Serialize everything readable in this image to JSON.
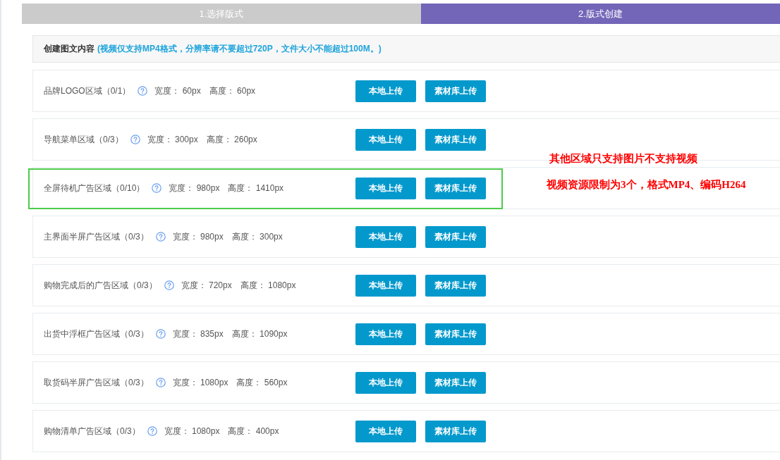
{
  "steps": [
    {
      "label": "1.选择版式",
      "selected": false
    },
    {
      "label": "2.版式创建",
      "selected": true
    }
  ],
  "content_header": {
    "title": "创建图文内容",
    "note": "(视频仅支持MP4格式，分辨率请不要超过720P，文件大小不能超过100M。)"
  },
  "regions": [
    {
      "name": "品牌LOGO区域（0/1）",
      "width": "宽度： 60px",
      "height": "高度： 60px",
      "highlighted": false,
      "buttons": [
        "本地上传",
        "素材库上传"
      ]
    },
    {
      "name": "导航菜单区域（0/3）",
      "width": "宽度： 300px",
      "height": "高度： 260px",
      "highlighted": false,
      "buttons": [
        "本地上传",
        "素材库上传"
      ]
    },
    {
      "name": "全屏待机广告区域（0/10）",
      "width": "宽度： 980px",
      "height": "高度： 1410px",
      "highlighted": true,
      "buttons": [
        "本地上传",
        "素材库上传"
      ]
    },
    {
      "name": "主界面半屏广告区域（0/3）",
      "width": "宽度： 980px",
      "height": "高度： 300px",
      "highlighted": false,
      "buttons": [
        "本地上传",
        "素材库上传"
      ]
    },
    {
      "name": "购物完成后的广告区域（0/3）",
      "width": "宽度： 720px",
      "height": "高度： 1080px",
      "highlighted": false,
      "buttons": [
        "本地上传",
        "素材库上传"
      ]
    },
    {
      "name": "出货中浮框广告区域（0/3）",
      "width": "宽度： 835px",
      "height": "高度： 1090px",
      "highlighted": false,
      "buttons": [
        "本地上传",
        "素材库上传"
      ]
    },
    {
      "name": "取货码半屏广告区域（0/3）",
      "width": "宽度： 1080px",
      "height": "高度： 560px",
      "highlighted": false,
      "buttons": [
        "本地上传",
        "素材库上传"
      ]
    },
    {
      "name": "购物清单广告区域（0/3）",
      "width": "宽度： 1080px",
      "height": "高度： 400px",
      "highlighted": false,
      "buttons": [
        "本地上传",
        "素材库上传"
      ]
    }
  ],
  "annotations": [
    "其他区域只支持图片不支持视频",
    "视频资源限制为3个，格式MP4、编码H264"
  ]
}
